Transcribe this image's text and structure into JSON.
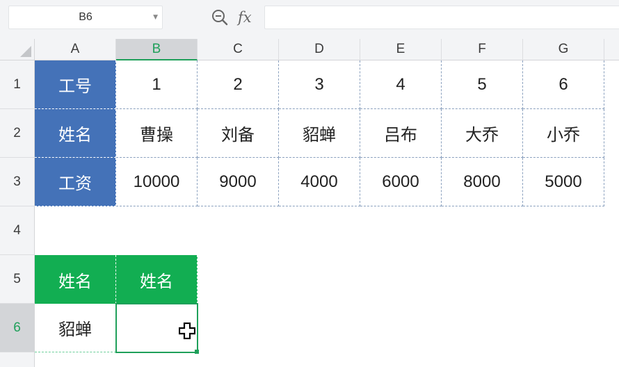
{
  "formula_bar": {
    "name_box": "B6",
    "formula": ""
  },
  "column_headers": [
    "A",
    "B",
    "C",
    "D",
    "E",
    "F",
    "G"
  ],
  "row_headers": [
    "1",
    "2",
    "3",
    "4",
    "5",
    "6"
  ],
  "selected_cell": "B6",
  "table1": {
    "row1": {
      "header": "工号",
      "values": [
        "1",
        "2",
        "3",
        "4",
        "5",
        "6"
      ]
    },
    "row2": {
      "header": "姓名",
      "values": [
        "曹操",
        "刘备",
        "貂蝉",
        "吕布",
        "大乔",
        "小乔"
      ]
    },
    "row3": {
      "header": "工资",
      "values": [
        "10000",
        "9000",
        "4000",
        "6000",
        "8000",
        "5000"
      ]
    }
  },
  "table2": {
    "headers": [
      "姓名",
      "姓名"
    ],
    "row6": [
      "貂蝉",
      ""
    ]
  },
  "colors": {
    "header_blue": "#4472b8",
    "header_green": "#12ae52",
    "selection_accent": "#1fa05a"
  },
  "icons": {
    "zoom": "magnifier-minus-icon",
    "fx": "fx-icon",
    "cursor": "cross-cursor-icon"
  }
}
